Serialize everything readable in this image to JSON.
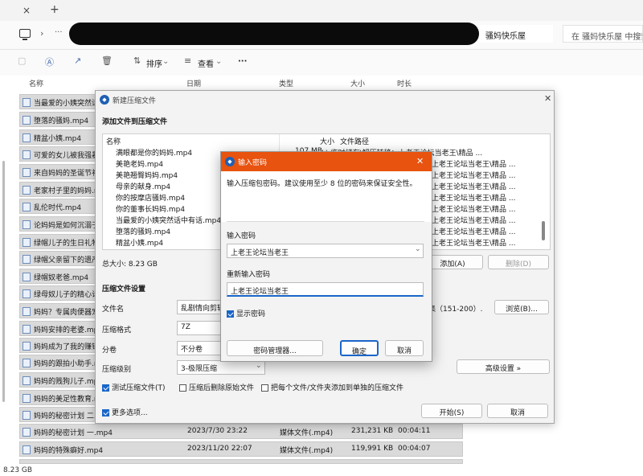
{
  "browser": {
    "close_icon": "×",
    "new_tab_icon": "+"
  },
  "address": {
    "crumb": "骚妈快乐屋",
    "search_placeholder": "在 骚妈快乐屋 中搜索"
  },
  "toolbar": {
    "sort_label": "排序",
    "view_label": "查看",
    "more_label": "···"
  },
  "columns": {
    "name": "名称",
    "date": "日期",
    "type": "类型",
    "size": "大小",
    "duration": "时长"
  },
  "files": [
    {
      "name": "当最爱的小姨突然话..."
    },
    {
      "name": "堕落的骚妈.mp4"
    },
    {
      "name": "精盆小姨.mp4"
    },
    {
      "name": "可爱的女儿被我强暴..."
    },
    {
      "name": "来自妈妈的圣诞节礼..."
    },
    {
      "name": "老家村子里的妈妈.mp4"
    },
    {
      "name": "乱伦时代.mp4"
    },
    {
      "name": "论妈妈是如何沉溺于..."
    },
    {
      "name": "绿帽儿子的生日礼物..."
    },
    {
      "name": "绿帽父亲留下的遗产..."
    },
    {
      "name": "绿帽奴老爸.mp4"
    },
    {
      "name": "绿母奴儿子的精心计..."
    },
    {
      "name": "妈妈？专属肉便器宠..."
    },
    {
      "name": "妈妈安排的老婆.mp4"
    },
    {
      "name": "妈妈成为了我的赚钱..."
    },
    {
      "name": "妈妈的跟拍小助手.mp4"
    },
    {
      "name": "妈妈的贱狗儿子.mp4"
    },
    {
      "name": "妈妈的美足性教育.mp4"
    },
    {
      "name": "妈妈的秘密计划 二.mp4"
    },
    {
      "name": "妈妈的秘密计划 一.mp4",
      "date": "2023/7/30 23:22",
      "type": "媒体文件(.mp4)",
      "size": "231,231 KB",
      "duration": "00:04:11"
    },
    {
      "name": "妈妈的特殊癖好.mp4",
      "date": "2023/11/20 22:07",
      "type": "媒体文件(.mp4)",
      "size": "119,991 KB",
      "duration": "00:04:07"
    }
  ],
  "status": {
    "selection_size": "8.23 GB"
  },
  "zip_dialog": {
    "title": "新建压缩文件",
    "add_section": "添加文件到压缩文件",
    "list_headers": {
      "name": "名称",
      "size": "大小",
      "path": "文件路径"
    },
    "list_items": [
      {
        "name": "满眼都是你的妈妈.mp4",
        "size": "107 MB",
        "path": "I:\\ 临时储存\\解压转移：上老王论坛当老王\\精品 ..."
      },
      {
        "name": "美艳老妈.mp4",
        "size": "",
        "path": "上老王论坛当老王\\精品 ..."
      },
      {
        "name": "美艳翘臀妈妈.mp4",
        "size": "",
        "path": "上老王论坛当老王\\精品 ..."
      },
      {
        "name": "母亲的献身.mp4",
        "size": "",
        "path": "上老王论坛当老王\\精品 ..."
      },
      {
        "name": "你的按摩店骚妈.mp4",
        "size": "",
        "path": "上老王论坛当老王\\精品 ..."
      },
      {
        "name": "你的董事长妈妈.mp4",
        "size": "",
        "path": "上老王论坛当老王\\精品 ..."
      },
      {
        "name": "当最爱的小姨突然话中有话.mp4",
        "size": "",
        "path": "上老王论坛当老王\\精品 ..."
      },
      {
        "name": "堕落的骚妈.mp4",
        "size": "",
        "path": "上老王论坛当老王\\精品 ..."
      },
      {
        "name": "精盆小姨.mp4",
        "size": "",
        "path": "上老王论坛当老王\\精品 ..."
      }
    ],
    "total_size": "总大小: 8.23 GB",
    "add_button": "添加(A)",
    "delete_button": "删除(D)",
    "settings_section": "压缩文件设置",
    "filename_label": "文件名",
    "filename_value": "乱剧情向剪辑·",
    "filename_suffix": "集（151-200）.",
    "browse_button": "浏览(B)...",
    "format_label": "压缩格式",
    "format_value": "7Z",
    "split_label": "分卷",
    "split_value": "不分卷",
    "level_label": "压缩级别",
    "level_value": "3-极限压缩",
    "advanced_button": "高级设置 »",
    "test_label": "测试压缩文件(T)",
    "delete_after_label": "压缩后删除原始文件",
    "separate_label": "把每个文件/文件夹添加到单独的压缩文件",
    "more_options_label": "更多选项...",
    "start_button": "开始(S)",
    "cancel_button": "取消"
  },
  "password_dialog": {
    "title": "输入密码",
    "hint": "输入压缩包密码。建议使用至少 8 位的密码来保证安全性。",
    "enter_label": "输入密码",
    "password_value": "上老王论坛当老王",
    "reenter_label": "重新输入密码",
    "reenter_value": "上老王论坛当老王",
    "show_password_label": "显示密码",
    "manager_button": "密码管理器...",
    "ok_button": "确定",
    "cancel_button": "取消",
    "close_icon": "✕",
    "accent_color": "#e8530f"
  }
}
